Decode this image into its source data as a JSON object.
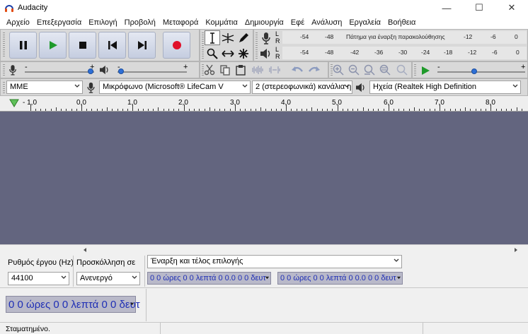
{
  "window": {
    "title": "Audacity",
    "minimize": "—",
    "maximize": "☐",
    "close": "✕"
  },
  "menu": [
    "Αρχείο",
    "Επεξεργασία",
    "Επιλογή",
    "Προβολή",
    "Μεταφορά",
    "Κομμάτια",
    "Δημιουργία",
    "Εφέ",
    "Ανάλυση",
    "Εργαλεία",
    "Βοήθεια"
  ],
  "meters": {
    "record": {
      "L": "L",
      "R": "R",
      "ticks": [
        "-54",
        "-48",
        "Πάτημα για έναρξη παρακολούθησης",
        "-12",
        "-6",
        "0"
      ]
    },
    "playback": {
      "L": "L",
      "R": "R",
      "ticks": [
        "-54",
        "-48",
        "-42",
        "-36",
        "-30",
        "-24",
        "-18",
        "-12",
        "-6",
        "0"
      ]
    }
  },
  "mixer": {
    "record_volume": 0.95,
    "playback_volume": 0.05,
    "minus": "-",
    "plus": "+"
  },
  "play_speed": {
    "value": 0.42,
    "minus": "-",
    "plus": "+"
  },
  "device": {
    "host": "MME",
    "input": "Μικρόφωνο (Microsoft® LifeCam V",
    "channels": "2 (στερεοφωνικά) κανάλια η",
    "output": "Ηχεία (Realtek High Definition"
  },
  "ruler": {
    "labels": [
      "- 1,0",
      "0,0",
      "1,0",
      "2,0",
      "3,0",
      "4,0",
      "5,0",
      "6,0",
      "7,0",
      "8,0"
    ]
  },
  "selection": {
    "rate_label": "Ρυθμός έργου (Hz)",
    "rate_value": "44100",
    "snap_label": "Προσκόλληση σε",
    "snap_value": "Ανενεργό",
    "mode_value": "Έναρξη και τέλος επιλογής",
    "time_start": {
      "h": "0 0",
      "hu": "ώρες",
      "m": "0 0",
      "mu": "λεπτά",
      "s": "0 0.0 0 0",
      "su": "δευτ"
    },
    "time_end": {
      "h": "0 0",
      "hu": "ώρες",
      "m": "0 0",
      "mu": "λεπτά",
      "s": "0 0.0 0 0",
      "su": "δευτ"
    }
  },
  "audio_position": {
    "h": "0 0",
    "hu": "ώρες",
    "m": "0 0",
    "mu": "λεπτά",
    "s": "0 0",
    "su": "δευτ"
  },
  "status": {
    "text": "Σταματημένο."
  },
  "colors": {
    "track_bg": "#63657f",
    "time_text": "#1f2fb5",
    "record_red": "#e0102a",
    "play_green": "#1e9a2a"
  }
}
